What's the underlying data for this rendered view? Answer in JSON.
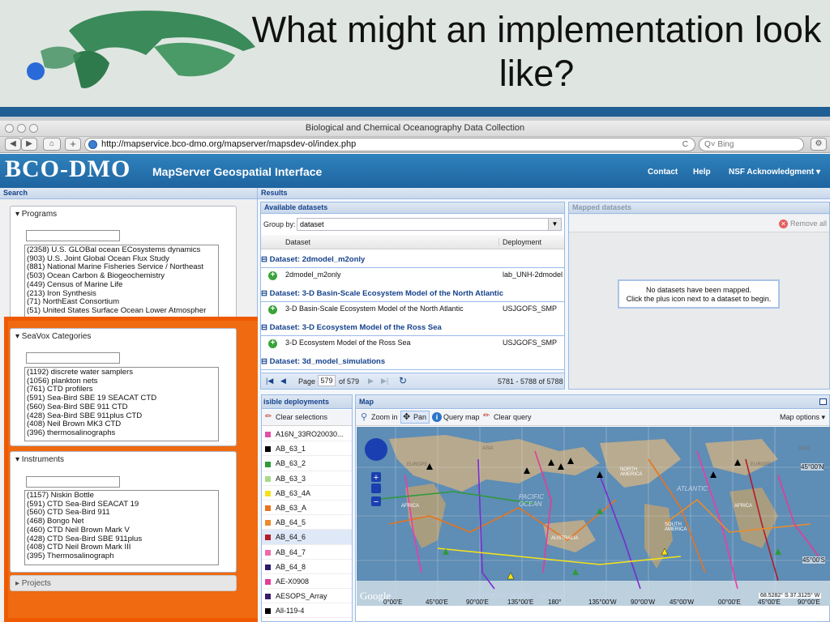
{
  "slide": {
    "title": "What might an implementation look like?"
  },
  "window": {
    "title": "Biological and Chemical Oceanography Data Collection"
  },
  "browser": {
    "url": "http://mapservice.bco-dmo.org/mapserver/mapsdev-ol/index.php",
    "search_placeholder": "Bing",
    "search_prefix": "Q˅",
    "back_label": "◀",
    "forward_label": "▶",
    "home_label": "⌂",
    "add_label": "+",
    "reload_label": "C",
    "bookmark_label": "⚙"
  },
  "app": {
    "brand": "BCO-DMO",
    "subtitle": "MapServer Geospatial Interface",
    "nav": [
      "Contact",
      "Help",
      "NSF Acknowledgment ▾"
    ]
  },
  "search": {
    "title": "Search",
    "programs": {
      "legend": "▾  Programs",
      "items": [
        "(2358) U.S. GLOBal ocean ECosystems dynamics",
        "(903) U.S. Joint Global Ocean Flux Study",
        "(881) National Marine Fisheries Service / Northeast",
        "(503) Ocean Carbon & Biogeochemistry",
        "(449) Census of Marine Life",
        "(213) Iron Synthesis",
        "(71) NorthEast Consortium",
        "(51) United States Surface Ocean Lower Atmospher"
      ]
    },
    "seavox": {
      "legend": "▾  SeaVox Categories",
      "items": [
        "(1192) discrete water samplers",
        "(1056) plankton nets",
        "(761) CTD profilers",
        "(591) Sea-Bird SBE 19 SEACAT CTD",
        "(560) Sea-Bird SBE 911 CTD",
        "(428) Sea-Bird SBE 911plus CTD",
        "(408) Neil Brown MK3 CTD",
        "(396) thermosalinographs"
      ]
    },
    "instruments": {
      "legend": "▾  Instruments",
      "items": [
        "(1157) Niskin Bottle",
        "(591) CTD Sea-Bird SEACAT 19",
        "(560) CTD Sea-Bird 911",
        "(468) Bongo Net",
        "(460) CTD Neil Brown Mark V",
        "(428) CTD Sea-Bird SBE 911plus",
        "(408) CTD Neil Brown Mark III",
        "(395) Thermosalinograph"
      ]
    },
    "projects": {
      "legend": "▸  Projects"
    }
  },
  "results": {
    "title": "Results",
    "available": {
      "title": "Available datasets",
      "group_by_label": "Group by:",
      "group_by_value": "dataset",
      "columns": [
        "Dataset",
        "Deployment"
      ],
      "groups": [
        {
          "header": "⊟ Dataset: 2dmodel_m2only",
          "row": {
            "dataset": "2dmodel_m2only",
            "deployment": "lab_UNH-2dmodel"
          }
        },
        {
          "header": "⊟ Dataset: 3-D Basin-Scale Ecosystem Model of the North Atlantic",
          "row": {
            "dataset": "3-D Basin-Scale Ecosystem Model of the North Atlantic",
            "deployment": "USJGOFS_SMP"
          }
        },
        {
          "header": "⊟ Dataset: 3-D Ecosystem Model of the Ross Sea",
          "row": {
            "dataset": "3-D Ecosystem Model of the Ross Sea",
            "deployment": "USJGOFS_SMP"
          }
        },
        {
          "header": "⊟ Dataset: 3d_model_simulations"
        }
      ],
      "pager": {
        "first": "|◀",
        "prev": "◀",
        "page_label": "Page",
        "page": "579",
        "of_label": "of 579",
        "next": "▶",
        "last": "▶|",
        "refresh": "↻",
        "range": "5781 - 5788 of 5788"
      }
    },
    "mapped": {
      "title": "Mapped datasets",
      "remove_all": "Remove all",
      "remove_icon": "✕",
      "empty_line1": "No datasets have been mapped.",
      "empty_line2": "Click the plus icon next to a dataset to begin."
    },
    "deployments": {
      "title": "isible deployments",
      "clear_label": "Clear selections",
      "items": [
        {
          "name": "A16N_33RO20030...",
          "color": "#e24fa9"
        },
        {
          "name": "AB_63_1",
          "color": "#000000"
        },
        {
          "name": "AB_63_2",
          "color": "#2e9a3a"
        },
        {
          "name": "AB_63_3",
          "color": "#a9d98a"
        },
        {
          "name": "AB_63_4A",
          "color": "#f4e219"
        },
        {
          "name": "AB_63_A",
          "color": "#e8741c"
        },
        {
          "name": "AB_64_5",
          "color": "#ea8c2b"
        },
        {
          "name": "AB_64_6",
          "color": "#b51a2a"
        },
        {
          "name": "AB_64_7",
          "color": "#ef6aa8"
        },
        {
          "name": "AB_64_8",
          "color": "#2b1b6e"
        },
        {
          "name": "AE-X0908",
          "color": "#e43b9a"
        },
        {
          "name": "AESOPS_Array",
          "color": "#3a1a6b"
        },
        {
          "name": "All-119-4",
          "color": "#000000"
        }
      ]
    },
    "map": {
      "title": "Map",
      "zoom_label": "Zoom in",
      "pan_label": "Pan",
      "query_label": "Query map",
      "clear_query_label": "Clear query",
      "options_label": "Map options ▾",
      "lat_labels": [
        "45°00'N",
        "45°00'S"
      ],
      "lon_labels": [
        "0°00'E",
        "45°00'E",
        "90°00'E",
        "135°00'E",
        "180°",
        "135°00'W",
        "90°00'W",
        "45°00'W",
        "00°00'E",
        "45°00'E",
        "90°00'E"
      ],
      "ocean_labels": [
        "EUROPE",
        "ASIA",
        "NORTH AMERICA",
        "PACIFIC OCEAN",
        "ATLANTIC",
        "AFRICA",
        "AUSTRALIA",
        "SOUTH AMERICA",
        "AFRICA",
        "SOUTHERN OCEAN",
        "OCEAN",
        "EUROPE",
        "ASIA"
      ],
      "coords": "68.5282° S 37.3125° W",
      "attribution": "Google"
    }
  }
}
